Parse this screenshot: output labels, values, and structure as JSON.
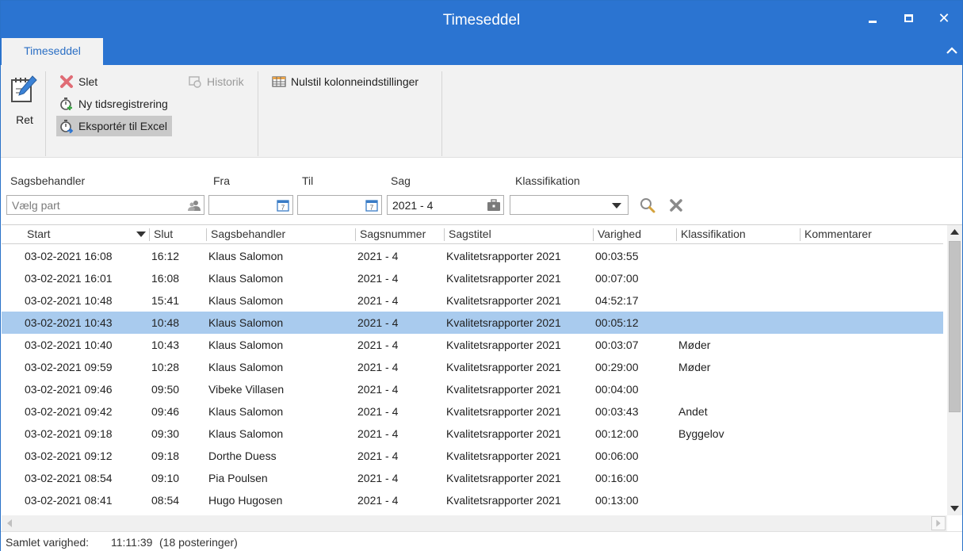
{
  "window": {
    "title": "Timeseddel"
  },
  "ribbon": {
    "tab_label": "Timeseddel",
    "ret_label": "Ret",
    "delete_label": "Slet",
    "new_registration_label": "Ny tidsregistrering",
    "export_label": "Eksportér til Excel",
    "history_label": "Historik",
    "reset_columns_label": "Nulstil kolonneindstillinger"
  },
  "filters": {
    "caseworker_label": "Sagsbehandler",
    "caseworker_placeholder": "Vælg part",
    "from_label": "Fra",
    "to_label": "Til",
    "case_label": "Sag",
    "case_value": "2021 - 4",
    "classification_label": "Klassifikation"
  },
  "grid": {
    "columns": {
      "start": "Start",
      "end": "Slut",
      "caseworker": "Sagsbehandler",
      "casenumber": "Sagsnummer",
      "casetitle": "Sagstitel",
      "duration": "Varighed",
      "classification": "Klassifikation",
      "comments": "Kommentarer"
    },
    "selected_row_index": 3,
    "rows": [
      {
        "start": "03-02-2021 16:08",
        "end": "16:12",
        "caseworker": "Klaus Salomon",
        "casenumber": "2021 - 4",
        "casetitle": "Kvalitetsrapporter 2021",
        "duration": "00:03:55",
        "classification": ""
      },
      {
        "start": "03-02-2021 16:01",
        "end": "16:08",
        "caseworker": "Klaus Salomon",
        "casenumber": "2021 - 4",
        "casetitle": "Kvalitetsrapporter 2021",
        "duration": "00:07:00",
        "classification": ""
      },
      {
        "start": "03-02-2021 10:48",
        "end": "15:41",
        "caseworker": "Klaus Salomon",
        "casenumber": "2021 - 4",
        "casetitle": "Kvalitetsrapporter 2021",
        "duration": "04:52:17",
        "classification": ""
      },
      {
        "start": "03-02-2021 10:43",
        "end": "10:48",
        "caseworker": "Klaus Salomon",
        "casenumber": "2021 - 4",
        "casetitle": "Kvalitetsrapporter 2021",
        "duration": "00:05:12",
        "classification": ""
      },
      {
        "start": "03-02-2021 10:40",
        "end": "10:43",
        "caseworker": "Klaus Salomon",
        "casenumber": "2021 - 4",
        "casetitle": "Kvalitetsrapporter 2021",
        "duration": "00:03:07",
        "classification": "Møder"
      },
      {
        "start": "03-02-2021 09:59",
        "end": "10:28",
        "caseworker": "Klaus Salomon",
        "casenumber": "2021 - 4",
        "casetitle": "Kvalitetsrapporter 2021",
        "duration": "00:29:00",
        "classification": "Møder"
      },
      {
        "start": "03-02-2021 09:46",
        "end": "09:50",
        "caseworker": "Vibeke Villasen",
        "casenumber": "2021 - 4",
        "casetitle": "Kvalitetsrapporter 2021",
        "duration": "00:04:00",
        "classification": ""
      },
      {
        "start": "03-02-2021 09:42",
        "end": "09:46",
        "caseworker": "Klaus Salomon",
        "casenumber": "2021 - 4",
        "casetitle": "Kvalitetsrapporter 2021",
        "duration": "00:03:43",
        "classification": "Andet"
      },
      {
        "start": "03-02-2021 09:18",
        "end": "09:30",
        "caseworker": "Klaus Salomon",
        "casenumber": "2021 - 4",
        "casetitle": "Kvalitetsrapporter 2021",
        "duration": "00:12:00",
        "classification": "Byggelov"
      },
      {
        "start": "03-02-2021 09:12",
        "end": "09:18",
        "caseworker": "Dorthe Duess",
        "casenumber": "2021 - 4",
        "casetitle": "Kvalitetsrapporter 2021",
        "duration": "00:06:00",
        "classification": ""
      },
      {
        "start": "03-02-2021 08:54",
        "end": "09:10",
        "caseworker": "Pia Poulsen",
        "casenumber": "2021 - 4",
        "casetitle": "Kvalitetsrapporter 2021",
        "duration": "00:16:00",
        "classification": ""
      },
      {
        "start": "03-02-2021 08:41",
        "end": "08:54",
        "caseworker": "Hugo Hugosen",
        "casenumber": "2021 - 4",
        "casetitle": "Kvalitetsrapporter 2021",
        "duration": "00:13:00",
        "classification": ""
      }
    ]
  },
  "status": {
    "total_label": "Samlet varighed:",
    "total_value": "11:11:39",
    "count_text": "(18 posteringer)"
  },
  "colors": {
    "title_bar": "#2b74d1",
    "ribbon_bg": "#f2f2f2",
    "selected_row": "#a9cbee",
    "tab_text": "#2b6fc4"
  }
}
